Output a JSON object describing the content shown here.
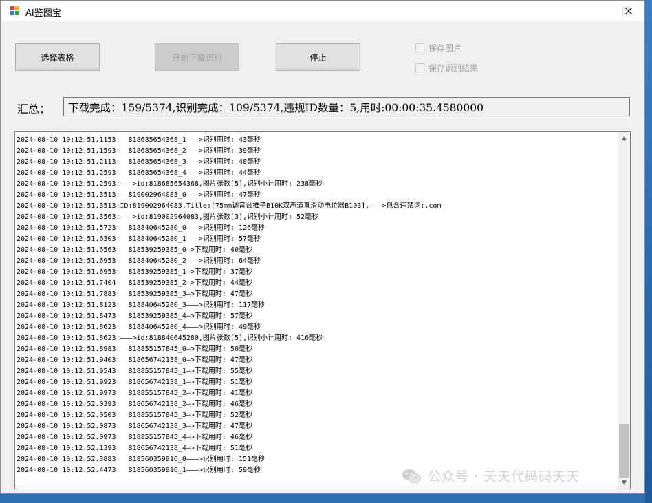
{
  "window": {
    "title": "AI鉴图宝"
  },
  "toolbar": {
    "select_table_label": "选择表格",
    "start_label": "开始下载识别",
    "stop_label": "停止",
    "save_images_label": "保存图片",
    "save_results_label": "保存识别结果"
  },
  "summary": {
    "label": "汇总：",
    "text": "下载完成：159/5374,识别完成：109/5374,违规ID数量：5,用时:00:00:35.4580000"
  },
  "log": [
    "2024-08-10 10:12:51.1153:  818685654368_1———>识别用时: 43毫秒",
    "2024-08-10 10:12:51.1593:  818685654368_2———>识别用时: 39毫秒",
    "2024-08-10 10:12:51.2113:  818685654368_3———>识别用时: 48毫秒",
    "2024-08-10 10:12:51.2593:  818685654368_4———>识别用时: 44毫秒",
    "2024-08-10 10:12:51.2593:———>id:818685654368,图片张数[5],识别小计用时: 238毫秒",
    "2024-08-10 10:12:51.3513:  819002964083_0———>识别用时: 47毫秒",
    "2024-08-10 10:12:51.3513:ID:819002964083,Title:[75mm调音台推子B10K双声道直滑动电位器B103],———>包含违禁词:.com",
    "2024-08-10 10:12:51.3563:———>id:819002964083,图片张数[3],识别小计用时: 52毫秒",
    "2024-08-10 10:12:51.5723:  818840645280_0———>识别用时: 126毫秒",
    "2024-08-10 10:12:51.6303:  818840645280_1———>识别用时: 57毫秒",
    "2024-08-10 10:12:51.6563:  818539259385_0—>下载用时: 40毫秒",
    "2024-08-10 10:12:51.6953:  818840645280_2———>识别用时: 64毫秒",
    "2024-08-10 10:12:51.6953:  818539259385_1—>下载用时: 37毫秒",
    "2024-08-10 10:12:51.7404:  818539259385_2—>下载用时: 44毫秒",
    "2024-08-10 10:12:51.7883:  818539259385_3—>下载用时: 47毫秒",
    "2024-08-10 10:12:51.8123:  818840645280_3———>识别用时: 117毫秒",
    "2024-08-10 10:12:51.8473:  818539259385_4—>下载用时: 57毫秒",
    "2024-08-10 10:12:51.8623:  818840645280_4———>识别用时: 49毫秒",
    "2024-08-10 10:12:51.8623:———>id:818840645280,图片张数[5],识别小计用时: 416毫秒",
    "2024-08-10 10:12:51.8983:  818855157845_0—>下载用时: 50毫秒",
    "2024-08-10 10:12:51.9403:  818656742138_0—>下载用时: 47毫秒",
    "2024-08-10 10:12:51.9543:  818855157845_1—>下载用时: 55毫秒",
    "2024-08-10 10:12:51.9923:  818656742138_1—>下载用时: 51毫秒",
    "2024-08-10 10:12:51.9973:  818855157845_2—>下载用时: 41毫秒",
    "2024-08-10 10:12:52.0393:  818656742138_2—>下载用时: 46毫秒",
    "2024-08-10 10:12:52.0503:  818855157845_3—>下载用时: 52毫秒",
    "2024-08-10 10:12:52.0873:  818656742138_3—>下载用时: 47毫秒",
    "2024-08-10 10:12:52.0973:  818855157845_4—>下载用时: 46毫秒",
    "2024-08-10 10:12:52.1393:  818656742138_4—>下载用时: 51毫秒",
    "2024-08-10 10:12:52.3883:  818560359916_0———>识别用时: 151毫秒",
    "2024-08-10 10:12:52.4473:  818560359916_1———>识别用时: 59毫秒"
  ],
  "watermark": {
    "text": "公众号 · 天天代码码天天",
    "icon": "wechat-icon"
  }
}
